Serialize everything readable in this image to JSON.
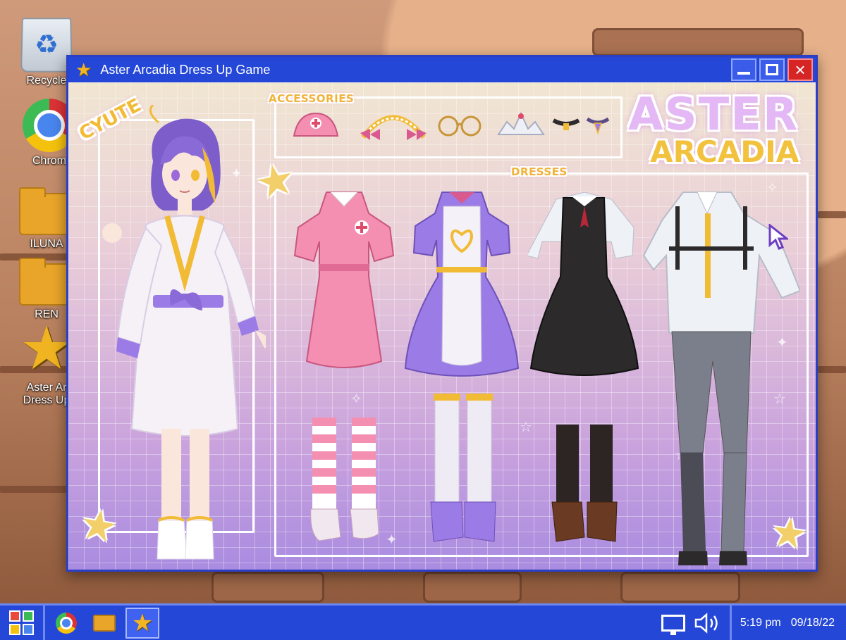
{
  "desktop": {
    "icons": [
      {
        "label": "Recycle",
        "icon": "recycle-bin-icon"
      },
      {
        "label": "Chrom",
        "icon": "chrome-icon"
      },
      {
        "label": "ILUNA",
        "icon": "folder-icon"
      },
      {
        "label": "REN",
        "icon": "folder-icon"
      },
      {
        "label_line1": "Aster Ar",
        "label_line2": "Dress Up",
        "icon": "star-icon"
      }
    ]
  },
  "window": {
    "title": "Aster Arcadia Dress Up Game",
    "minimize": "minimize-icon",
    "maximize": "maximize-icon",
    "close": "×"
  },
  "game": {
    "logo_line1": "ASTER",
    "logo_line2": "ARCADIA",
    "character_tag": "CYUTE",
    "accessories_label": "ACCESSORIES",
    "dresses_label": "DRESSES",
    "accessories": [
      "nurse-cap-icon",
      "maid-headband-icon",
      "round-glasses-icon",
      "tiara-icon",
      "choker-icon",
      "pendant-choker-icon"
    ],
    "outfits": [
      "nurse-outfit",
      "maid-outfit",
      "school-dress-outfit",
      "harness-shirt-outfit"
    ],
    "colors": {
      "accent_gold": "#f2bb35",
      "logo_lilac": "#e3b8f5",
      "nurse_pink": "#f48fb1",
      "maid_purple": "#9b7be6",
      "black_dress": "#2c2a2a",
      "shirt_white": "#eef1f6"
    }
  },
  "taskbar": {
    "time": "5:19 pm",
    "date": "09/18/22",
    "apps": [
      "chrome-icon",
      "folder-icon",
      "star-icon"
    ]
  }
}
